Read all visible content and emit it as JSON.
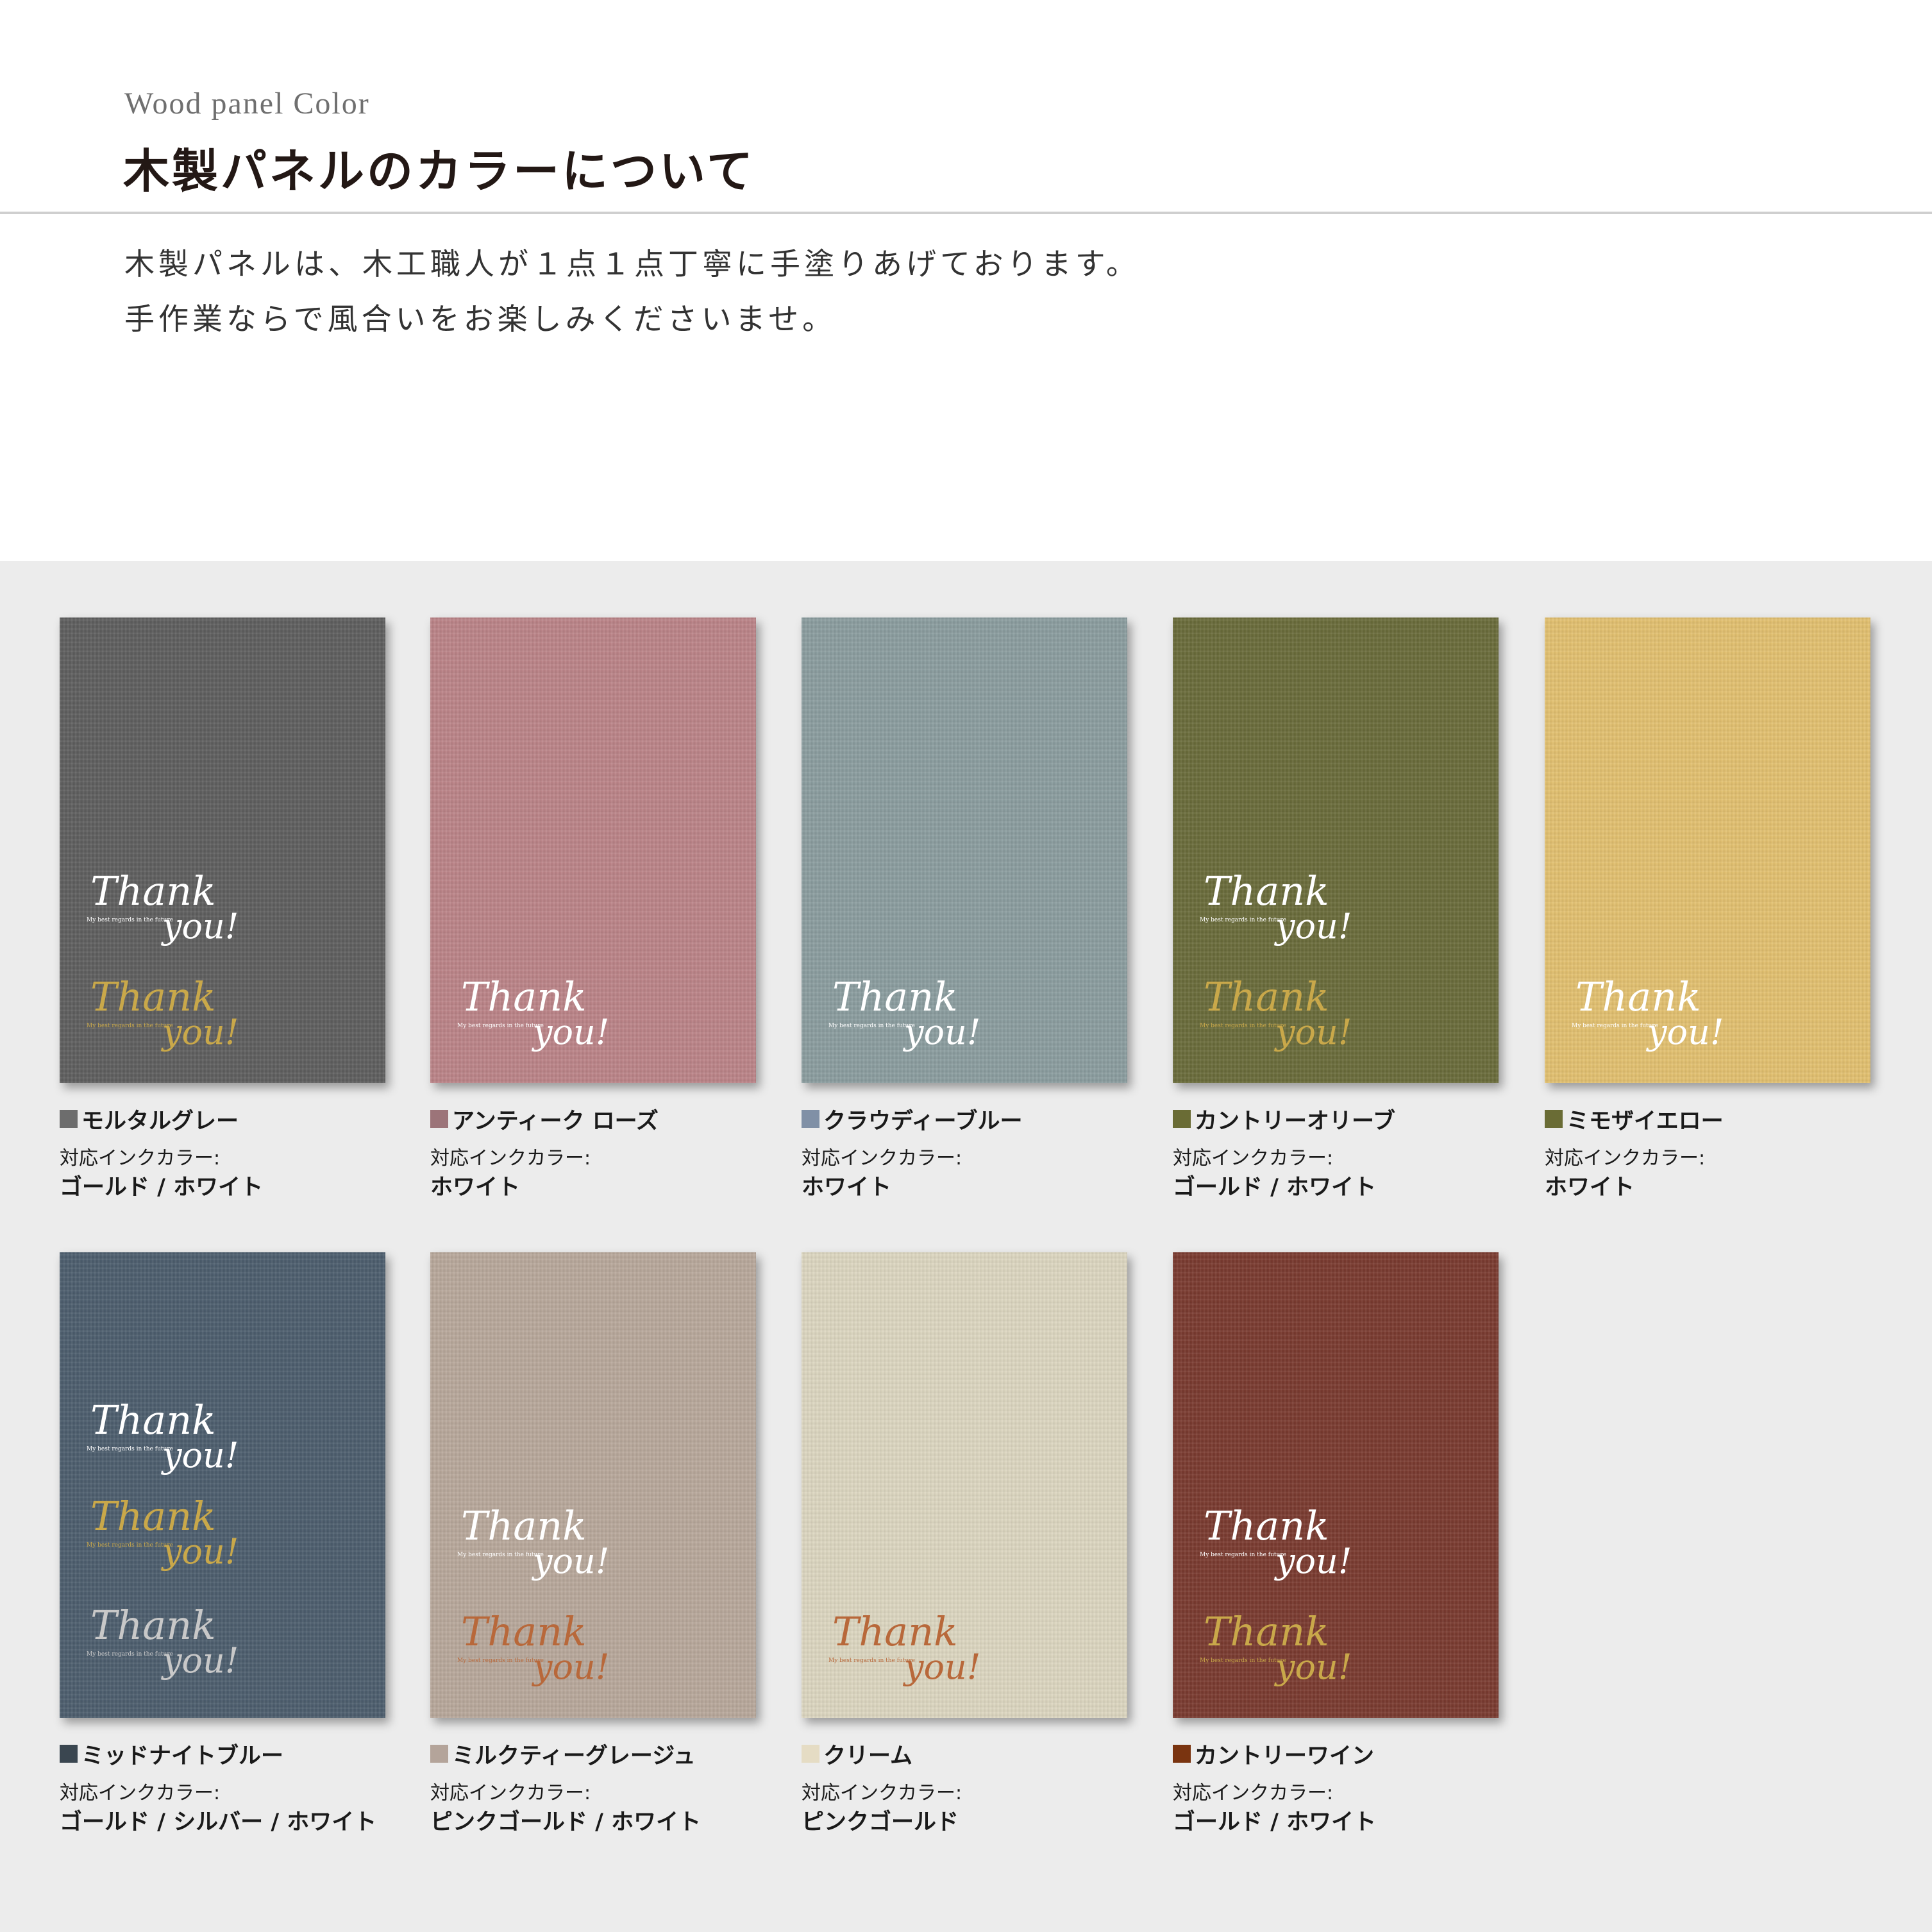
{
  "header": {
    "subtitle": "Wood panel Color",
    "title": "木製パネルのカラーについて",
    "description": [
      "木製パネルは、木工職人が１点１点丁寧に手塗りあげております。",
      "手作業ならで風合いをお楽しみくださいませ。"
    ]
  },
  "ink_label": "対応インクカラー:",
  "panel_text": {
    "script": "Thank you!",
    "tagline": "My best regards in the future"
  },
  "colors": [
    {
      "name": "モルタルグレー",
      "swatch": "#6d6d6d",
      "panel": "#5f5f5f",
      "inks": "ゴールド / ホワイト"
    },
    {
      "name": "アンティーク ローズ",
      "swatch": "#9c7479",
      "panel": "#bb8488",
      "inks": "ホワイト"
    },
    {
      "name": "クラウディーブルー",
      "swatch": "#8090a6",
      "panel": "#8b9d9f",
      "inks": "ホワイト"
    },
    {
      "name": "カントリーオリーブ",
      "swatch": "#6a6c35",
      "panel": "#6a6c3b",
      "inks": "ゴールド / ホワイト"
    },
    {
      "name": "ミモザイエロー",
      "swatch": "#6a6c35",
      "panel": "#e2c070",
      "inks": "ホワイト"
    },
    {
      "name": "ミッドナイトブルー",
      "swatch": "#3a4650",
      "panel": "#4d5e6e",
      "inks": "ゴールド / シルバー / ホワイト"
    },
    {
      "name": "ミルクティーグレージュ",
      "swatch": "#b4a49a",
      "panel": "#b8a89b",
      "inks": "ピンクゴールド / ホワイト"
    },
    {
      "name": "クリーム",
      "swatch": "#e5dcc4",
      "panel": "#dcd6c0",
      "inks": "ピンクゴールド"
    },
    {
      "name": "カントリーワイン",
      "swatch": "#7a3410",
      "panel": "#7a3b30",
      "inks": "ゴールド / ホワイト"
    }
  ]
}
